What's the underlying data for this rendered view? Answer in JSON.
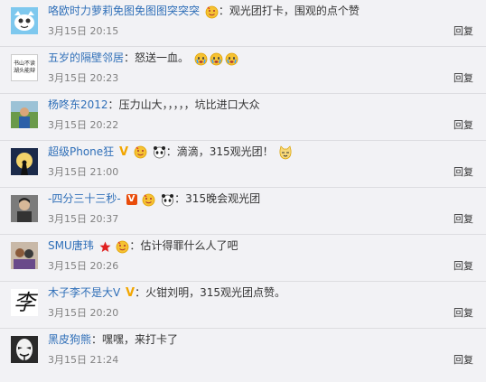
{
  "comments": [
    {
      "user": "咯欧时力萝莉免图免图图突突突",
      "colon": "：",
      "text": "观光团打卡，围观的点个赞",
      "time": "3月15日 20:15",
      "reply": "回复"
    },
    {
      "user": "五岁的隔壁邻居",
      "colon": "：",
      "text": "怒送一血。",
      "time": "3月15日 20:23",
      "reply": "回复",
      "avatar_text": "书山不读\n湖头能辩"
    },
    {
      "user": "杨咚东2012",
      "colon": "：",
      "text": "压力山大，，，，，坑比进口大众",
      "time": "3月15日 20:22",
      "reply": "回复"
    },
    {
      "user": "超级Phone狂",
      "colon": "：",
      "text": "滴滴，315观光团！",
      "time": "3月15日 21:00",
      "reply": "回复"
    },
    {
      "user": "-四分三十三秒-",
      "colon": "：",
      "text": "315晚会观光团",
      "time": "3月15日 20:37",
      "reply": "回复"
    },
    {
      "user": "SMU唐玮",
      "colon": "：",
      "text": "估计得罪什么人了吧",
      "time": "3月15日 20:26",
      "reply": "回复"
    },
    {
      "user": "木子李不是大V",
      "colon": "：",
      "text": "火钳刘明，315观光团点赞。",
      "time": "3月15日 20:20",
      "reply": "回复",
      "avatar_text": "李"
    },
    {
      "user": "黑皮狗熊",
      "colon": "：",
      "text": "嘿嘿，来打卡了",
      "time": "3月15日 21:24",
      "reply": "回复"
    }
  ],
  "colors": {
    "link": "#2f6fb8",
    "time": "#808080",
    "bg": "#f2f2f5",
    "divider": "#dcdce0"
  }
}
